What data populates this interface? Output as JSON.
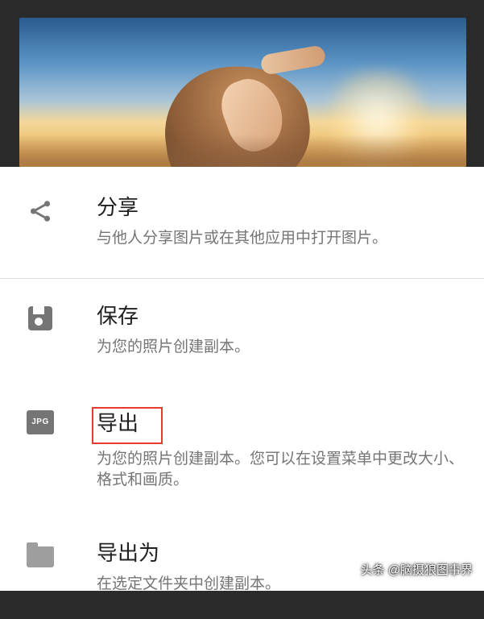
{
  "menu": {
    "share": {
      "title": "分享",
      "desc": "与他人分享图片或在其他应用中打开图片。"
    },
    "save": {
      "title": "保存",
      "desc": "为您的照片创建副本。"
    },
    "export": {
      "title": "导出",
      "desc": "为您的照片创建副本。您可以在设置菜单中更改大小、格式和画质。",
      "jpg_label": "JPG"
    },
    "exportAs": {
      "title": "导出为",
      "desc": "在选定文件夹中创建副本。"
    }
  },
  "watermark": "头条 @脑摄狼图事界"
}
